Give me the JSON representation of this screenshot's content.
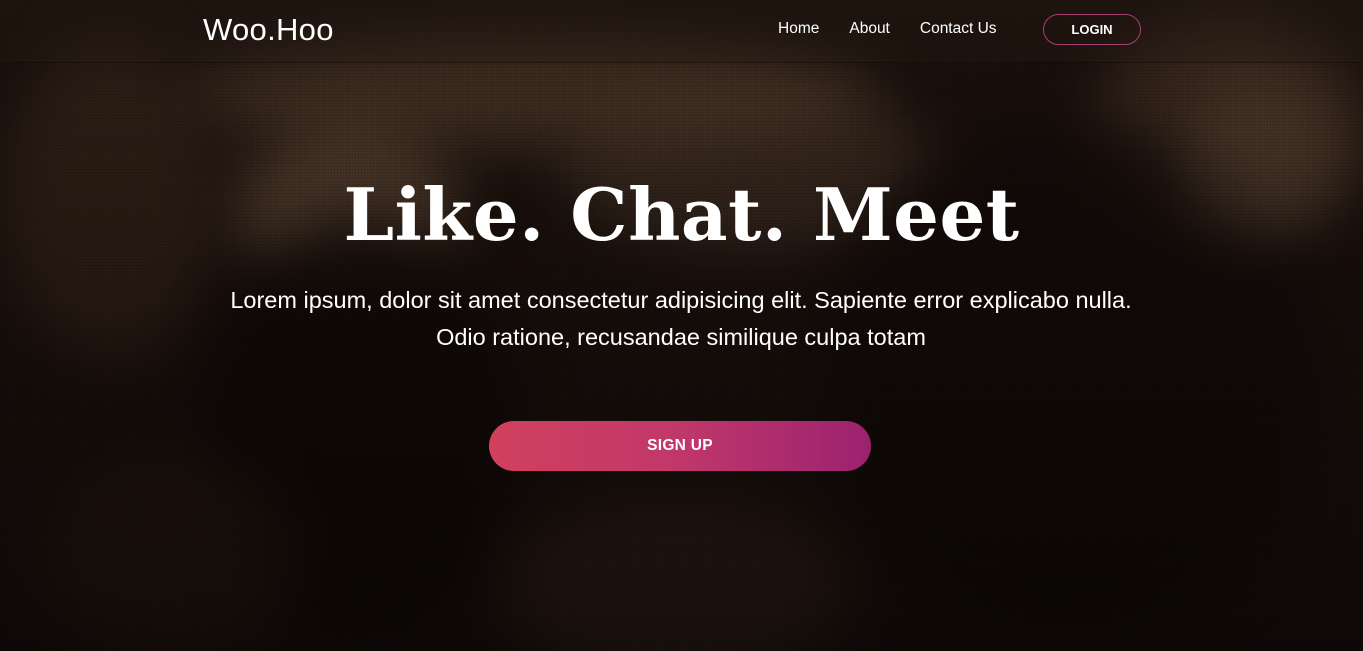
{
  "navbar": {
    "brand": "Woo.Hoo",
    "links": [
      {
        "label": "Home"
      },
      {
        "label": "About"
      },
      {
        "label": "Contact Us"
      }
    ],
    "login_label": "LOGIN"
  },
  "hero": {
    "headline": "Like. Chat. Meet",
    "subtext": "Lorem ipsum, dolor sit amet consectetur adipisicing elit. Sapiente error explicabo nulla. Odio ratione, recusandae similique culpa totam",
    "signup_label": "SIGN UP"
  },
  "colors": {
    "accent_start": "#d1405d",
    "accent_end": "#9b2270",
    "login_border": "#a63f73",
    "text": "#ffffff"
  }
}
